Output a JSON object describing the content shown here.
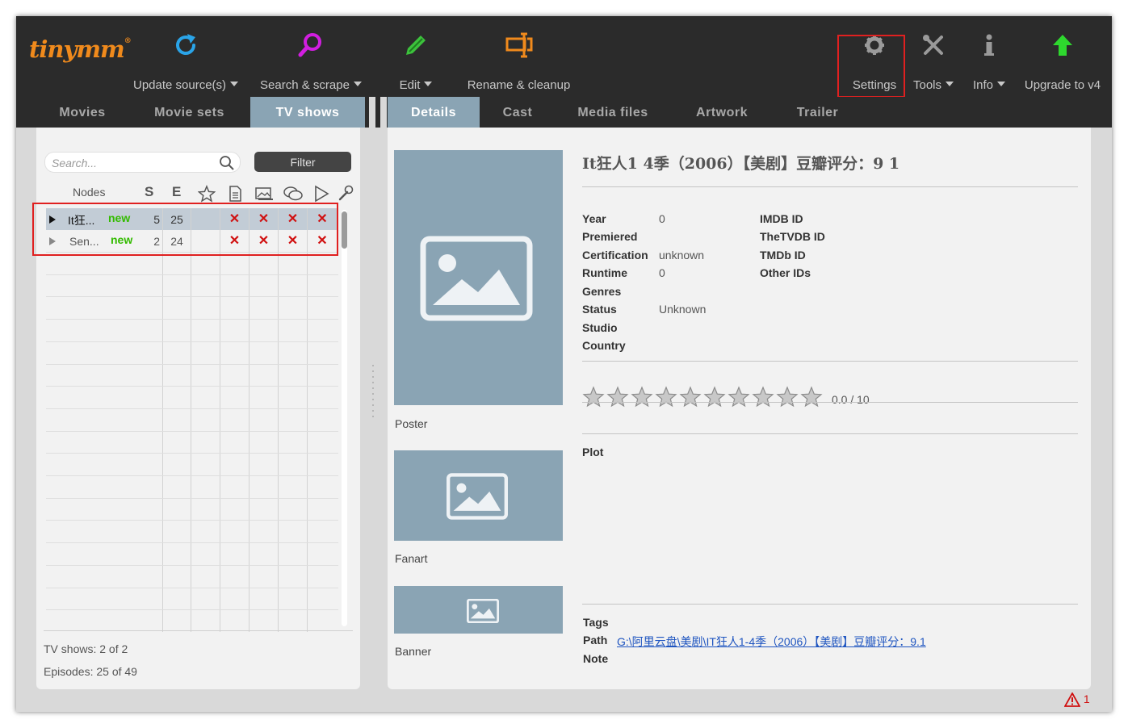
{
  "app": {
    "logo_text": "tinymm",
    "logo_reg": "®"
  },
  "toolbar": {
    "update_label": "Update source(s)",
    "search_label": "Search & scrape",
    "edit_label": "Edit",
    "rename_label": "Rename & cleanup",
    "settings_label": "Settings",
    "tools_label": "Tools",
    "info_label": "Info",
    "upgrade_label": "Upgrade to v4"
  },
  "main_tabs": [
    "Movies",
    "Movie sets",
    "TV shows"
  ],
  "main_tabs_active": "TV shows",
  "detail_tabs": [
    "Details",
    "Cast",
    "Media files",
    "Artwork",
    "Trailer"
  ],
  "detail_tabs_active": "Details",
  "left": {
    "search_placeholder": "Search...",
    "filter_label": "Filter",
    "col_nodes": "Nodes",
    "col_s": "S",
    "col_e": "E",
    "rows": [
      {
        "title": "It狂...",
        "badge": "new",
        "seasons": "5",
        "episodes": "25",
        "x1": "✕",
        "x2": "✕",
        "x3": "✕",
        "x4": "✕"
      },
      {
        "title": "Sen...",
        "badge": "new",
        "seasons": "2",
        "episodes": "24",
        "x1": "✕",
        "x2": "✕",
        "x3": "✕",
        "x4": "✕"
      }
    ],
    "tvshows_text": "TV shows:  2  of  2",
    "episodes_text": "Episodes:  25  of  49"
  },
  "details": {
    "title": "It狂人1 4季（2006）【美剧】豆瓣评分：9 1",
    "poster_label": "Poster",
    "fanart_label": "Fanart",
    "banner_label": "Banner",
    "labels": {
      "year": "Year",
      "premiered": "Premiered",
      "certification": "Certification",
      "runtime": "Runtime",
      "genres": "Genres",
      "status": "Status",
      "studio": "Studio",
      "country": "Country",
      "imdb": "IMDB ID",
      "tvdb": "TheTVDB ID",
      "tmdb": "TMDb ID",
      "other": "Other IDs",
      "plot": "Plot",
      "tags": "Tags",
      "path": "Path",
      "note": "Note"
    },
    "values": {
      "year": "0",
      "certification": "unknown",
      "runtime": "0",
      "status": "Unknown"
    },
    "rating_text": "0.0 / 10",
    "rating_value": 0,
    "rating_max": 10,
    "path_value": "G:\\阿里云盘\\美剧\\IT狂人1-4季（2006）【美剧】豆瓣评分：9.1"
  },
  "status_bar": {
    "warning_count": "1"
  },
  "colors": {
    "accent": "#8aa4b4",
    "toolbar_bg": "#2b2b2b",
    "highlight": "#e02020",
    "new_badge": "#33bb00",
    "error": "#d01010"
  }
}
